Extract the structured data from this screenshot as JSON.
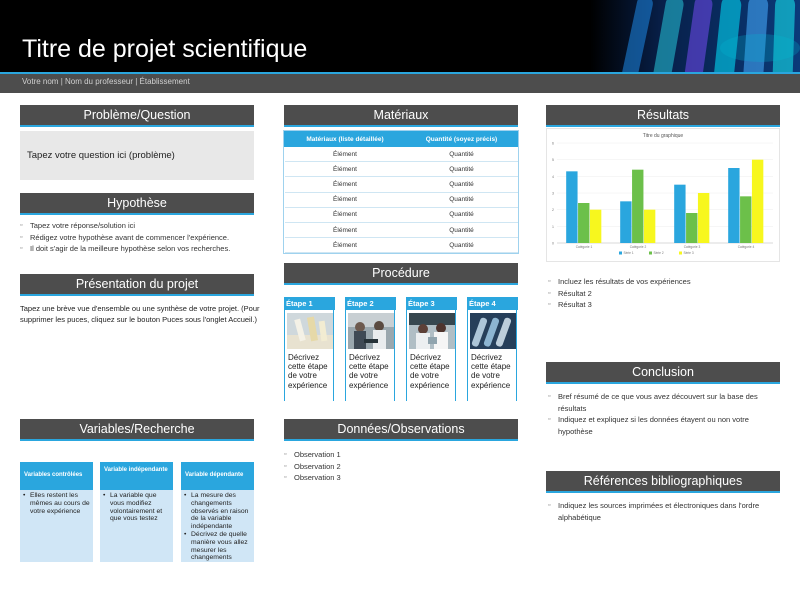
{
  "header": {
    "title": "Titre de projet scientifique",
    "subtitle": "Votre nom | Nom du professeur | Établissement"
  },
  "sections": {
    "probleme": "Problème/Question",
    "hypothese": "Hypothèse",
    "presentation": "Présentation du projet",
    "variables": "Variables/Recherche",
    "materiaux": "Matériaux",
    "procedure": "Procédure",
    "donnees": "Données/Observations",
    "resultats": "Résultats",
    "conclusion": "Conclusion",
    "references": "Références bibliographiques"
  },
  "probleme": {
    "text": "Tapez votre question ici (problème)"
  },
  "hypothese": {
    "bullets": [
      "Tapez votre réponse/solution ici",
      "Rédigez votre hypothèse avant de commencer l'expérience.",
      "Il doit s'agir de la meilleure hypothèse selon vos recherches."
    ]
  },
  "presentation": {
    "text": "Tapez une brève vue d'ensemble ou une synthèse de votre projet. (Pour supprimer les puces, cliquez sur le bouton Puces sous l'onglet Accueil.)"
  },
  "variables": {
    "columns": [
      {
        "title": "Variables contrôlées",
        "items": [
          "Elles restent les mêmes au cours de votre expérience"
        ]
      },
      {
        "title": "Variable indépendante",
        "items": [
          "La variable que vous modifiez volontairement et que vous testez"
        ]
      },
      {
        "title": "Variable dépendante",
        "items": [
          "La mesure des changements observés en raison de la variable indépendante",
          "Décrivez de quelle manière vous allez mesurer les changements"
        ]
      }
    ]
  },
  "materiaux": {
    "headers": [
      "Matériaux (liste détaillée)",
      "Quantité (soyez précis)"
    ],
    "rows": [
      [
        "Élément",
        "Quantité"
      ],
      [
        "Élément",
        "Quantité"
      ],
      [
        "Élément",
        "Quantité"
      ],
      [
        "Élément",
        "Quantité"
      ],
      [
        "Élément",
        "Quantité"
      ],
      [
        "Élément",
        "Quantité"
      ],
      [
        "Élément",
        "Quantité"
      ]
    ]
  },
  "procedure": {
    "steps": [
      {
        "label": "Étape 1",
        "text": "Décrivez cette étape de votre expérience"
      },
      {
        "label": "Étape 2",
        "text": "Décrivez cette étape de votre expérience"
      },
      {
        "label": "Étape 3",
        "text": "Décrivez cette étape de votre expérience"
      },
      {
        "label": "Étape 4",
        "text": "Décrivez cette étape de votre expérience"
      }
    ]
  },
  "donnees": {
    "bullets": [
      "Observation 1",
      "Observation 2",
      "Observation 3"
    ]
  },
  "resultats": {
    "bullets": [
      "Incluez les résultats de vos expériences",
      "Résultat 2",
      "Résultat 3"
    ]
  },
  "conclusion": {
    "bullets": [
      "Bref résumé de ce que vous avez découvert sur la base des résultats",
      "Indiquez et expliquez si les données étayent ou non votre hypothèse"
    ]
  },
  "references": {
    "bullets": [
      "Indiquez les sources imprimées et électroniques dans l'ordre alphabétique"
    ]
  },
  "chart_data": {
    "type": "bar",
    "title": "Titre du graphique",
    "categories": [
      "Catégorie 1",
      "Catégorie 2",
      "Catégorie 3",
      "Catégorie 4"
    ],
    "series": [
      {
        "name": "Série 1",
        "values": [
          4.3,
          2.5,
          3.5,
          4.5
        ],
        "color": "#2aa6de"
      },
      {
        "name": "Série 2",
        "values": [
          2.4,
          4.4,
          1.8,
          2.8
        ],
        "color": "#6cc04a"
      },
      {
        "name": "Série 3",
        "values": [
          2.0,
          2.0,
          3.0,
          5.0
        ],
        "color": "#f7f71e"
      }
    ],
    "yticks": [
      "0",
      "1",
      "2",
      "3",
      "4",
      "5",
      "6"
    ],
    "ylim": [
      0,
      6
    ],
    "legend": "bottom"
  },
  "colors": {
    "accent": "#2aa6de",
    "section_header": "#4d4d4d",
    "light_blue": "#d0e6f6"
  }
}
